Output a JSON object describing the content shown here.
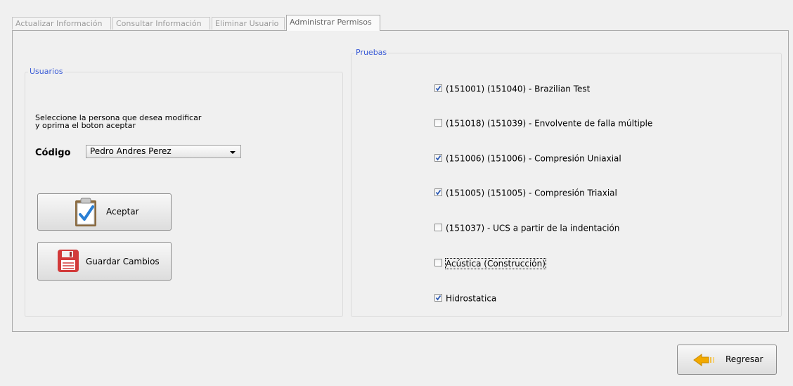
{
  "tabs": [
    {
      "label": "Actualizar Información",
      "active": false
    },
    {
      "label": "Consultar Información",
      "active": false
    },
    {
      "label": "Eliminar Usuario",
      "active": false
    },
    {
      "label": "Administrar Permisos",
      "active": true
    }
  ],
  "usuarios": {
    "legend": "Usuarios",
    "instruction_line1": "Seleccione la persona que desea modificar",
    "instruction_line2": "y oprima el boton aceptar",
    "codigo_label": "Código",
    "codigo_value": "Pedro Andres Perez",
    "accept_label": "Aceptar",
    "save_label": "Guardar Cambios"
  },
  "pruebas": {
    "legend": "Pruebas",
    "items": [
      {
        "label": "(151001) (151040) - Brazilian Test",
        "checked": true
      },
      {
        "label": "(151018) (151039) - Envolvente de falla múltiple",
        "checked": false
      },
      {
        "label": "(151006) (151006) - Compresión Uniaxial",
        "checked": true
      },
      {
        "label": "(151005) (151005) - Compresión Triaxial",
        "checked": true
      },
      {
        "label": "(151037) - UCS a partir de la indentación",
        "checked": false
      },
      {
        "label": "Acústica (Construcción)",
        "checked": false,
        "focused": true
      },
      {
        "label": "Hidrostatica",
        "checked": true
      }
    ]
  },
  "footer": {
    "back_label": "Regresar"
  },
  "colors": {
    "legend_text": "#3a5bd6",
    "check_mark": "#2a58b3",
    "arrow": "#f2a900"
  },
  "icons": {
    "accept": "clipboard-check-icon",
    "save": "floppy-disk-icon",
    "back": "arrow-left-icon",
    "dropdown": "chevron-down-icon"
  }
}
